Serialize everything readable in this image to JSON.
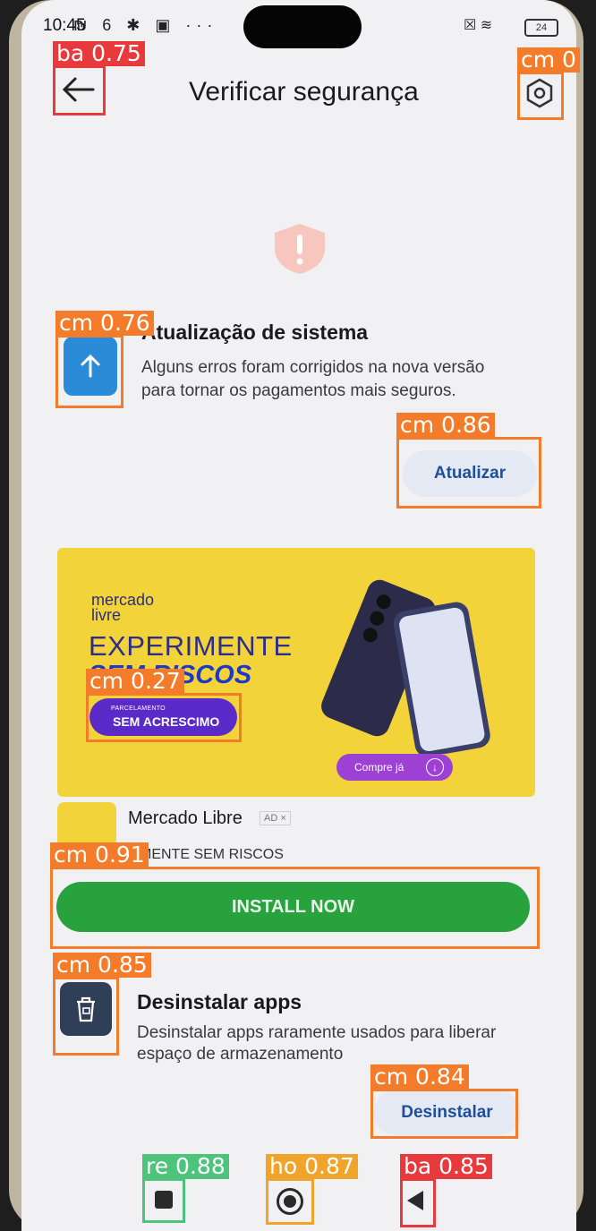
{
  "status": {
    "time": "10:45",
    "battery": "24"
  },
  "header": {
    "title": "Verificar segurança"
  },
  "update": {
    "title": "Atualização de sistema",
    "description": "Alguns erros foram corrigidos na nova versão para tornar os pagamentos mais seguros.",
    "button": "Atualizar"
  },
  "ad": {
    "banner_brand": "mercado livre",
    "headline_1": "EXPERIMENTE",
    "headline_2": "SEM RISCOS",
    "chip_small": "PARCELAMENTO",
    "chip_big": "SEM ACRESCIMO",
    "cta_small": "Compre já",
    "app_name": "Mercado Libre",
    "badge": "AD ×",
    "tagline": "RIMENTE SEM RISCOS",
    "install_button": "INSTALL NOW"
  },
  "uninstall": {
    "title": "Desinstalar apps",
    "description": "Desinstalar apps raramente usados para liberar espaço de armazenamento",
    "button": "Desinstalar"
  },
  "detections": {
    "back": "ba 0.75",
    "settings": "cm 0",
    "update_icon": "cm 0.76",
    "update_button": "cm 0.86",
    "chip": "cm 0.27",
    "install": "cm 0.91",
    "uninstall_icon": "cm 0.85",
    "uninstall_button": "cm 0.84",
    "nav_recent": "re 0.88",
    "nav_home": "ho 0.87",
    "nav_back": "ba 0.85"
  },
  "colors": {
    "update_icon": "#2a8bd9",
    "install": "#27a23d",
    "banner": "#f3d33a",
    "chip": "#5b2bc9"
  }
}
